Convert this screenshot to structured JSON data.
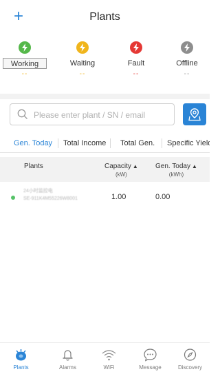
{
  "header": {
    "title": "Plants",
    "add_label": "+"
  },
  "statuses": [
    {
      "label": "Working",
      "count": "--",
      "color": "#55b84a"
    },
    {
      "label": "Waiting",
      "count": "--",
      "color": "#f0b51c"
    },
    {
      "label": "Fault",
      "count": "--",
      "color": "#e53935"
    },
    {
      "label": "Offline",
      "count": "--",
      "color": "#8e8e8e"
    }
  ],
  "search": {
    "placeholder": "Please enter plant / SN / email"
  },
  "tabs": [
    {
      "label": "Gen. Today",
      "active": true
    },
    {
      "label": "Total Income",
      "active": false
    },
    {
      "label": "Total Gen.",
      "active": false
    },
    {
      "label": "Specific Yield",
      "active": false
    }
  ],
  "table": {
    "columns": [
      {
        "label": "Plants",
        "unit": ""
      },
      {
        "label": "Capacity",
        "unit": "(kW)"
      },
      {
        "label": "Gen. Today",
        "unit": "(kWh)"
      }
    ],
    "rows": [
      {
        "name": "24小时监控电",
        "sn": "SE-911K4M55226W8001",
        "capacity": "1.00",
        "gen_today": "0.00",
        "status_color": "#55c267"
      }
    ]
  },
  "nav": [
    {
      "label": "Plants",
      "icon": "plants-icon",
      "active": true
    },
    {
      "label": "Alarms",
      "icon": "bell-icon",
      "active": false
    },
    {
      "label": "WiFi",
      "icon": "wifi-icon",
      "active": false
    },
    {
      "label": "Message",
      "icon": "chat-icon",
      "active": false
    },
    {
      "label": "Discovery",
      "icon": "compass-icon",
      "active": false
    }
  ],
  "colors": {
    "accent": "#2a84d6"
  }
}
